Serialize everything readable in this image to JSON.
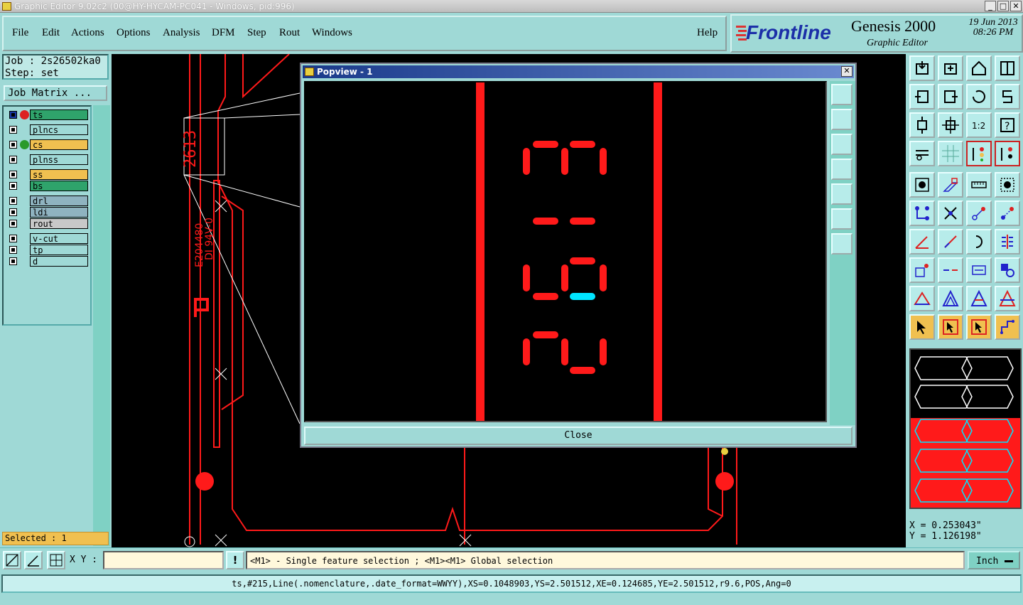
{
  "window": {
    "title": "Graphic Editor 9.02c2 (00@HY-HYCAM-PC041 - Windows, pid:996)",
    "min_label": "_",
    "max_label": "□",
    "close_label": "✕"
  },
  "menu": {
    "items": [
      "File",
      "Edit",
      "Actions",
      "Options",
      "Analysis",
      "DFM",
      "Step",
      "Rout",
      "Windows"
    ],
    "help": "Help"
  },
  "brand": {
    "logo": "Frontline",
    "product": "Genesis 2000",
    "subtitle": "Graphic Editor",
    "date": "19 Jun 2013",
    "time": "08:26 PM"
  },
  "job": {
    "job_line": "Job : 2s26502ka0",
    "step_line": "Step: set",
    "matrix_button": "Job Matrix ..."
  },
  "layers": [
    {
      "name": "ts",
      "color": "#2fa36b",
      "marker": "work"
    },
    {
      "name": "plncs",
      "color": "#9fd9d6",
      "marker": ""
    },
    {
      "name": "cs",
      "color": "#f0c050",
      "marker": "green-dot"
    },
    {
      "name": "plnss",
      "color": "#9fd9d6",
      "marker": ""
    },
    {
      "name": "ss",
      "color": "#f0c050",
      "marker": ""
    },
    {
      "name": "bs",
      "color": "#2fa36b",
      "marker": ""
    },
    {
      "name": "drl",
      "color": "#8fb3c0",
      "marker": ""
    },
    {
      "name": "ldi",
      "color": "#8fb3c0",
      "marker": ""
    },
    {
      "name": "rout",
      "color": "#c8c8c8",
      "marker": ""
    },
    {
      "name": "v-cut",
      "color": "#9fd9d6",
      "marker": ""
    },
    {
      "name": "tp",
      "color": "#9fd9d6",
      "marker": ""
    },
    {
      "name": "d",
      "color": "#9fd9d6",
      "marker": ""
    }
  ],
  "selected_text": "Selected : 1",
  "canvas_text": {
    "small_digits": "2613",
    "ul_code": "E204480",
    "ul_code2": "DI 94V-0"
  },
  "popup": {
    "title": "Popview - 1",
    "close_label": "Close",
    "x_label": "✕",
    "digits": "2613"
  },
  "coords": {
    "x": "X = 0.253043\"",
    "y": "Y = 1.126198\""
  },
  "bottom": {
    "xy_label": "X Y :",
    "xy_value": "",
    "hint": "<M1> - Single feature selection ; <M1><M1> Global selection",
    "unit": "Inch",
    "status": "ts,#215,Line(.nomenclature,.date_format=WWYY),XS=0.1048903,YS=2.501512,XE=0.124685,YE=2.501512,r9.6,POS,Ang=0"
  },
  "colors": {
    "accent": "#9fd9d6",
    "feature_red": "#ff0000",
    "highlight": "#00e5ff",
    "selected_bg": "#f0c050"
  }
}
